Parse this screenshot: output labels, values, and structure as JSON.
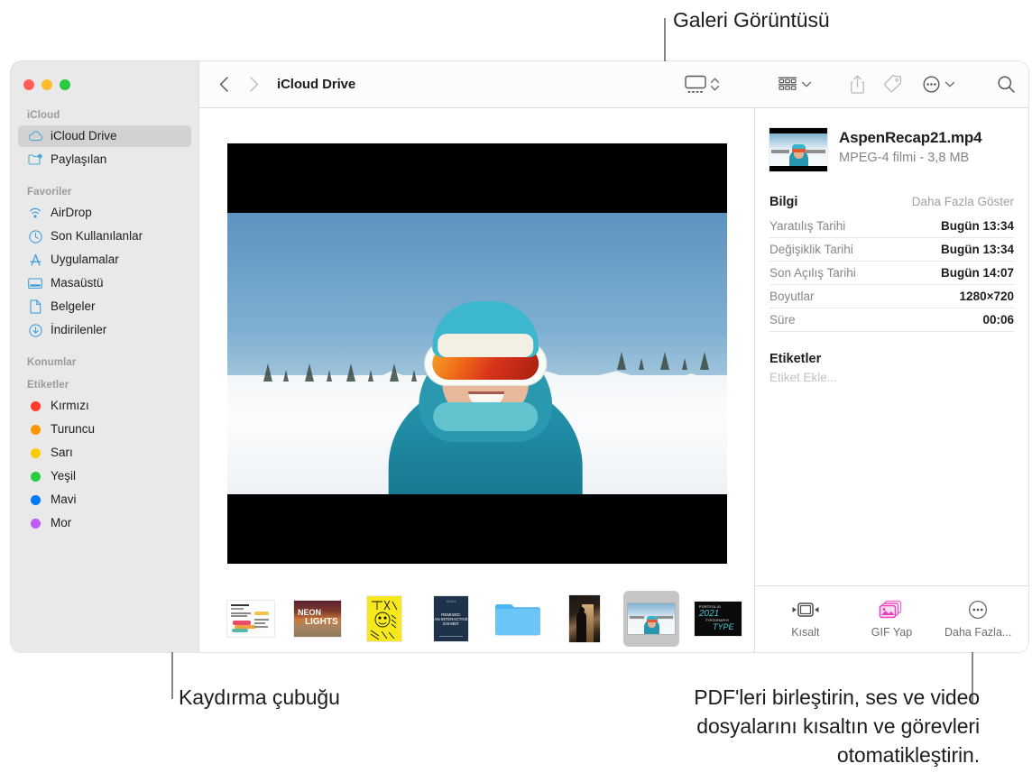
{
  "callouts": {
    "gallery_view": "Galeri Görüntüsü",
    "scrollbar": "Kaydırma çubuğu",
    "quick_actions": "PDF'leri birleştirin, ses ve video\ndosyalarını kısaltın ve görevleri\notomatikleştirin."
  },
  "window": {
    "traffic_lights": {
      "close": "close-button",
      "minimize": "minimize-button",
      "zoom": "zoom-button"
    }
  },
  "sidebar": {
    "sections": [
      {
        "header": "iCloud",
        "items": [
          {
            "label": "iCloud Drive",
            "icon": "cloud-icon",
            "selected": true
          },
          {
            "label": "Paylaşılan",
            "icon": "shared-folder-icon",
            "selected": false
          }
        ]
      },
      {
        "header": "Favoriler",
        "items": [
          {
            "label": "AirDrop",
            "icon": "airdrop-icon",
            "selected": false
          },
          {
            "label": "Son Kullanılanlar",
            "icon": "clock-icon",
            "selected": false
          },
          {
            "label": "Uygulamalar",
            "icon": "applications-icon",
            "selected": false
          },
          {
            "label": "Masaüstü",
            "icon": "desktop-icon",
            "selected": false
          },
          {
            "label": "Belgeler",
            "icon": "document-icon",
            "selected": false
          },
          {
            "label": "İndirilenler",
            "icon": "downloads-icon",
            "selected": false
          }
        ]
      },
      {
        "header": "Konumlar",
        "items": []
      },
      {
        "header": "Etiketler",
        "items": [
          {
            "label": "Kırmızı",
            "icon": "tag-dot-icon",
            "color": "#ff3b30"
          },
          {
            "label": "Turuncu",
            "icon": "tag-dot-icon",
            "color": "#ff9500"
          },
          {
            "label": "Sarı",
            "icon": "tag-dot-icon",
            "color": "#ffcc00"
          },
          {
            "label": "Yeşil",
            "icon": "tag-dot-icon",
            "color": "#28cd41"
          },
          {
            "label": "Mavi",
            "icon": "tag-dot-icon",
            "color": "#007aff"
          },
          {
            "label": "Mor",
            "icon": "tag-dot-icon",
            "color": "#bf5af2"
          }
        ]
      }
    ]
  },
  "toolbar": {
    "back": "back-button",
    "forward": "forward-button",
    "path_title": "iCloud Drive",
    "view_gallery": "gallery-view-button",
    "view_chevron": "view-options-chevron",
    "group_by": "group-by-button",
    "group_chevron": "group-by-chevron",
    "share": "share-button",
    "tags": "tags-button",
    "more": "more-actions-button",
    "more_chevron": "more-actions-chevron",
    "search": "search-button"
  },
  "inspector": {
    "file_name": "AspenRecap21.mp4",
    "file_meta": "MPEG-4 filmi - 3,8 MB",
    "info_title": "Bilgi",
    "show_more": "Daha Fazla Göster",
    "rows": [
      {
        "key": "Yaratılış Tarihi",
        "value": "Bugün 13:34"
      },
      {
        "key": "Değişiklik Tarihi",
        "value": "Bugün 13:34"
      },
      {
        "key": "Son Açılış Tarihi",
        "value": "Bugün 14:07"
      },
      {
        "key": "Boyutlar",
        "value": "1280×720"
      },
      {
        "key": "Süre",
        "value": "00:06"
      }
    ],
    "tags_title": "Etiketler",
    "tags_placeholder": "Etiket Ekle...",
    "quick_actions": [
      {
        "label": "Kısalt",
        "icon": "trim-icon"
      },
      {
        "label": "GIF Yap",
        "icon": "make-gif-icon"
      },
      {
        "label": "Daha Fazla...",
        "icon": "more-circle-icon"
      }
    ]
  },
  "filmstrip": {
    "items": [
      {
        "name": "infographic-document-thumbnail",
        "selected": false
      },
      {
        "name": "neon-lights-poster-thumbnail",
        "selected": false,
        "line1": "NEON",
        "line2": "LIGHTS"
      },
      {
        "name": "thank-you-yellow-poster-thumbnail",
        "selected": false
      },
      {
        "name": "navy-exhibit-poster-thumbnail",
        "selected": false,
        "line1": "01X21",
        "line2": "REMIXED:",
        "line3": "AN INTERACTIVE",
        "line4": "EXHIBIT"
      },
      {
        "name": "folder-thumbnail",
        "selected": false
      },
      {
        "name": "dark-silhouette-photo-thumbnail",
        "selected": false
      },
      {
        "name": "aspen-recap-video-thumbnail",
        "selected": true
      },
      {
        "name": "portfolio-2021-type-thumbnail",
        "selected": false,
        "line1": "PORTFOLIO",
        "line2": "2021",
        "line3": "TYPOGRAPHY",
        "line4": "TYPE"
      },
      {
        "name": "gold-balloons-photo-thumbnail",
        "selected": false
      }
    ]
  }
}
